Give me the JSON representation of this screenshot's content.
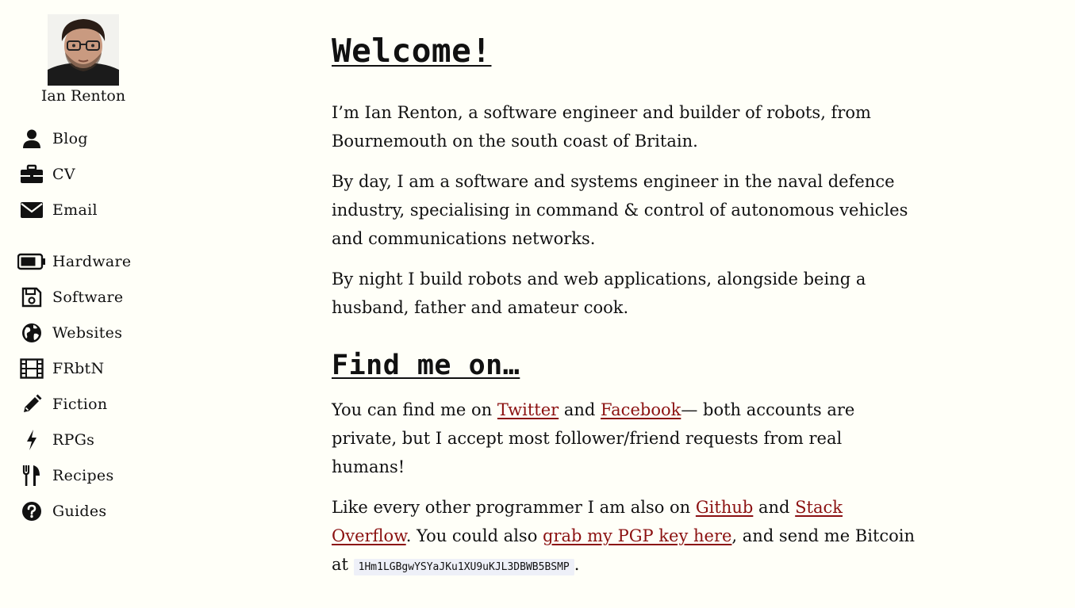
{
  "sidebar": {
    "author_name": "Ian Renton",
    "nav": [
      {
        "label": "Blog",
        "icon": "user-icon"
      },
      {
        "label": "CV",
        "icon": "briefcase-icon"
      },
      {
        "label": "Email",
        "icon": "envelope-icon"
      },
      {
        "label": "Hardware",
        "icon": "battery-icon"
      },
      {
        "label": "Software",
        "icon": "floppy-disk-icon"
      },
      {
        "label": "Websites",
        "icon": "globe-icon"
      },
      {
        "label": "FRbtN",
        "icon": "film-icon"
      },
      {
        "label": "Fiction",
        "icon": "pencil-icon"
      },
      {
        "label": "RPGs",
        "icon": "lightning-icon"
      },
      {
        "label": "Recipes",
        "icon": "utensils-icon"
      },
      {
        "label": "Guides",
        "icon": "question-circle-icon"
      }
    ]
  },
  "main": {
    "welcome_title": "Welcome!",
    "intro_1": "I’m Ian Renton, a software engineer and builder of robots, from Bournemouth on the south coast of Britain.",
    "intro_2": "By day, I am a software and systems engineer in the naval defence industry, specialising in command & control of autonomous vehicles and communications networks.",
    "intro_3": "By night I build robots and web applications, alongside being a husband, father and amateur cook.",
    "find_title": "Find me on…",
    "social": {
      "pre": "You can find me on ",
      "twitter": "Twitter",
      "and": " and ",
      "facebook": "Facebook",
      "post": "— both accounts are private, but I accept most follower/friend requests from real humans!"
    },
    "dev": {
      "pre": "Like every other programmer I am also on ",
      "github": "Github",
      "and": " and ",
      "stack": "Stack Overflow",
      "mid": ". You could also ",
      "pgp": "grab my PGP key here",
      "mid2": ", and send me Bitcoin at ",
      "bitcoin": "1Hm1LGBgwYSYaJKu1XU9uKJL3DBWB5BSMP",
      "end": "."
    }
  },
  "colors": {
    "background": "#fffff8",
    "text": "#111111",
    "link": "#8b1111",
    "code_bg": "#eef0f8"
  }
}
